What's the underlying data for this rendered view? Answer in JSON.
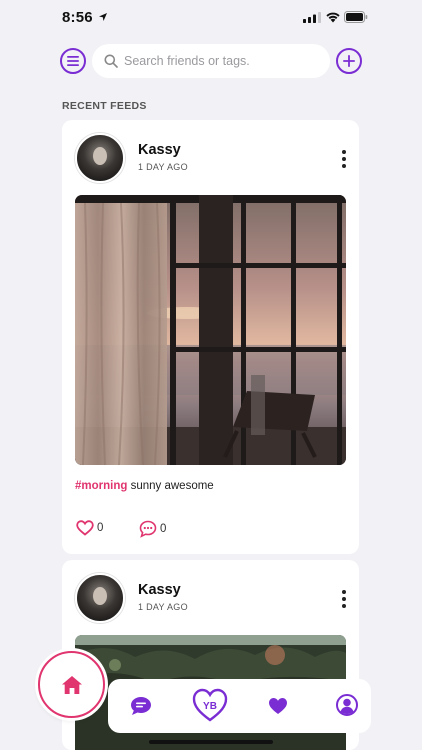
{
  "status_bar": {
    "time": "8:56"
  },
  "search": {
    "placeholder": "Search friends or tags."
  },
  "section": {
    "label": "RECENT FEEDS"
  },
  "posts": [
    {
      "author": "Kassy",
      "time": "1 DAY AGO",
      "hashtag": "#morning",
      "caption": " sunny awesome",
      "likes": "0",
      "comments": "0"
    },
    {
      "author": "Kassy",
      "time": "1 DAY AGO"
    }
  ],
  "bottom_nav": {
    "logo_text": "YB"
  },
  "colors": {
    "accent": "#7a2dd3",
    "pink": "#e0356f",
    "background": "#f2f2f6"
  },
  "icons": [
    "location-arrow-icon",
    "signal-icon",
    "wifi-icon",
    "battery-icon",
    "menu-icon",
    "search-icon",
    "add-icon",
    "more-icon",
    "heart-outline-icon",
    "comment-icon",
    "home-icon",
    "chat-icon",
    "yb-logo-icon",
    "heart-icon",
    "profile-icon"
  ]
}
